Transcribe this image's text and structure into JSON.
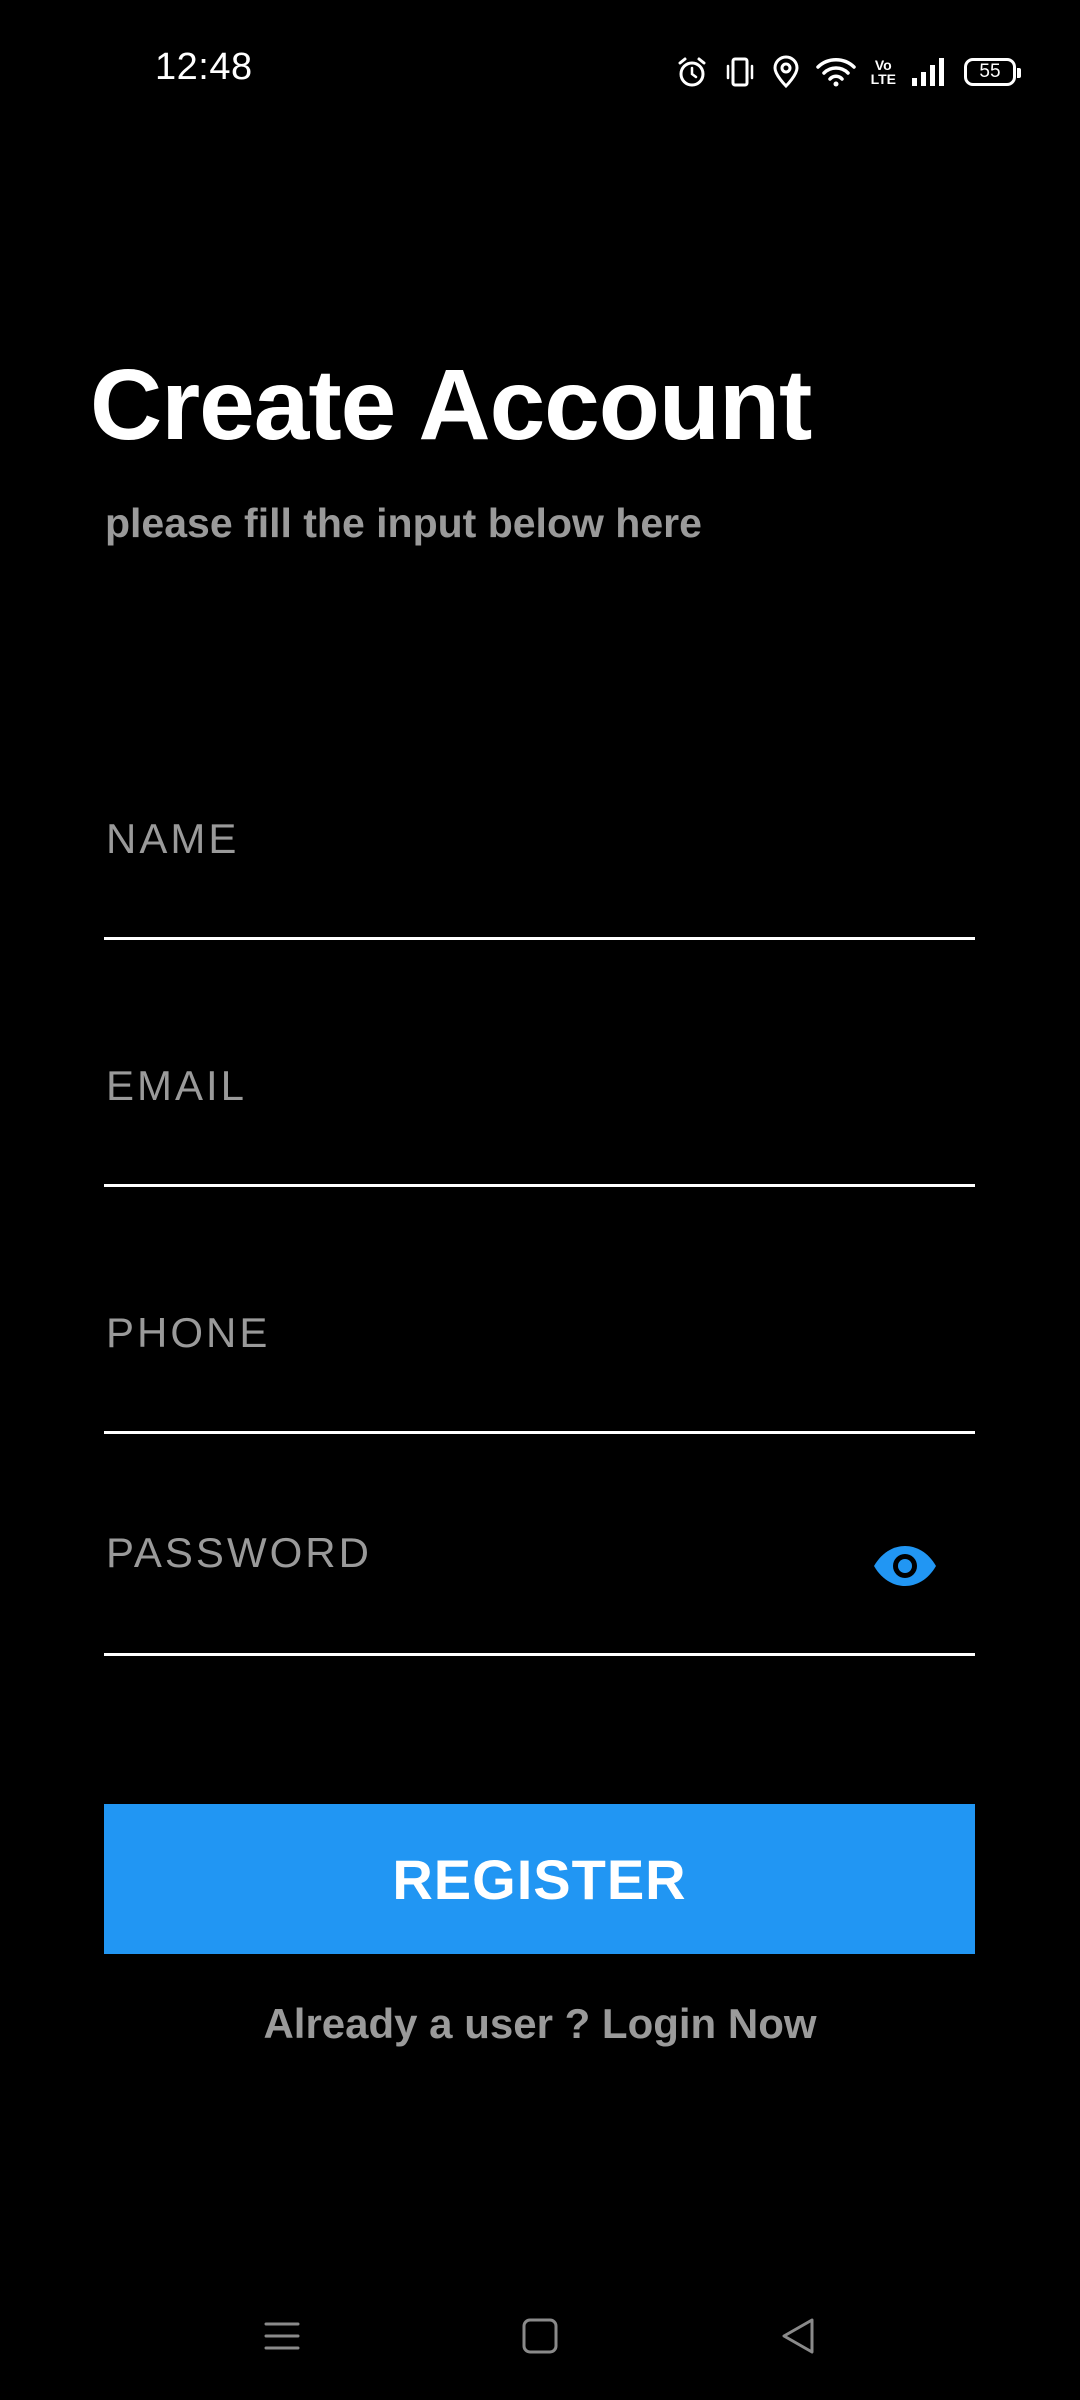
{
  "status_bar": {
    "time": "12:48",
    "battery_level": "55",
    "icons": [
      "alarm-icon",
      "vibrate-icon",
      "location-icon",
      "wifi-icon",
      "volte-icon",
      "signal-icon",
      "battery-icon"
    ],
    "volte_label_top": "Vo",
    "volte_label_bottom": "LTE"
  },
  "header": {
    "title": "Create Account",
    "subtitle": "please fill the input below here"
  },
  "form": {
    "name_placeholder": "NAME",
    "email_placeholder": "EMAIL",
    "phone_placeholder": "PHONE",
    "password_placeholder": "PASSWORD",
    "password_toggle_icon": "eye-icon",
    "name_value": "",
    "email_value": "",
    "phone_value": "",
    "password_value": ""
  },
  "actions": {
    "register_label": "REGISTER",
    "login_prompt": "Already a user ? Login Now"
  },
  "nav_bar": {
    "icons": [
      "menu-icon",
      "home-icon",
      "back-icon"
    ]
  },
  "colors": {
    "background": "#000000",
    "accent": "#2196F3",
    "text_primary": "#FFFFFF",
    "text_secondary": "#9A9A9A"
  }
}
